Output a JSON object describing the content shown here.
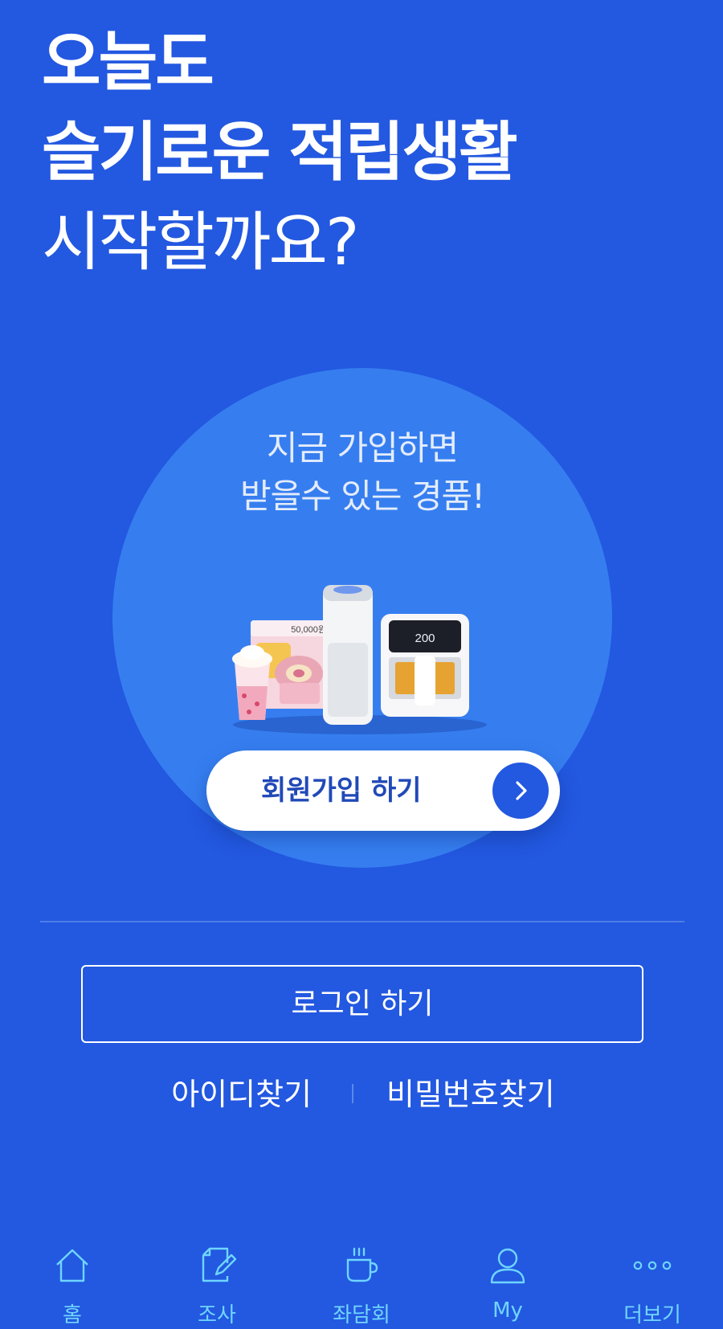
{
  "headline": {
    "line1": "오늘도",
    "line2": "슬기로운 적립생활",
    "line3": "시작할까요?"
  },
  "promo": {
    "line1": "지금 가입하면",
    "line2": "받을수 있는 경품!",
    "voucher_text": "50,000원",
    "airfryer_display": "200"
  },
  "signup": {
    "label": "회원가입 하기",
    "icon": "chevron-right-icon"
  },
  "auth": {
    "login_label": "로그인 하기",
    "find_id": "아이디찾기",
    "find_password": "비밀번호찾기"
  },
  "tabbar": {
    "items": [
      {
        "label": "홈",
        "icon": "home-icon"
      },
      {
        "label": "조사",
        "icon": "survey-icon"
      },
      {
        "label": "좌담회",
        "icon": "coffee-cup-icon"
      },
      {
        "label": "My",
        "icon": "user-icon"
      },
      {
        "label": "더보기",
        "icon": "more-dots-icon"
      }
    ]
  },
  "colors": {
    "background": "#2358e0",
    "circle": "#367ef0",
    "tab_accent": "#6fd6ff",
    "signup_text": "#2149b8"
  }
}
